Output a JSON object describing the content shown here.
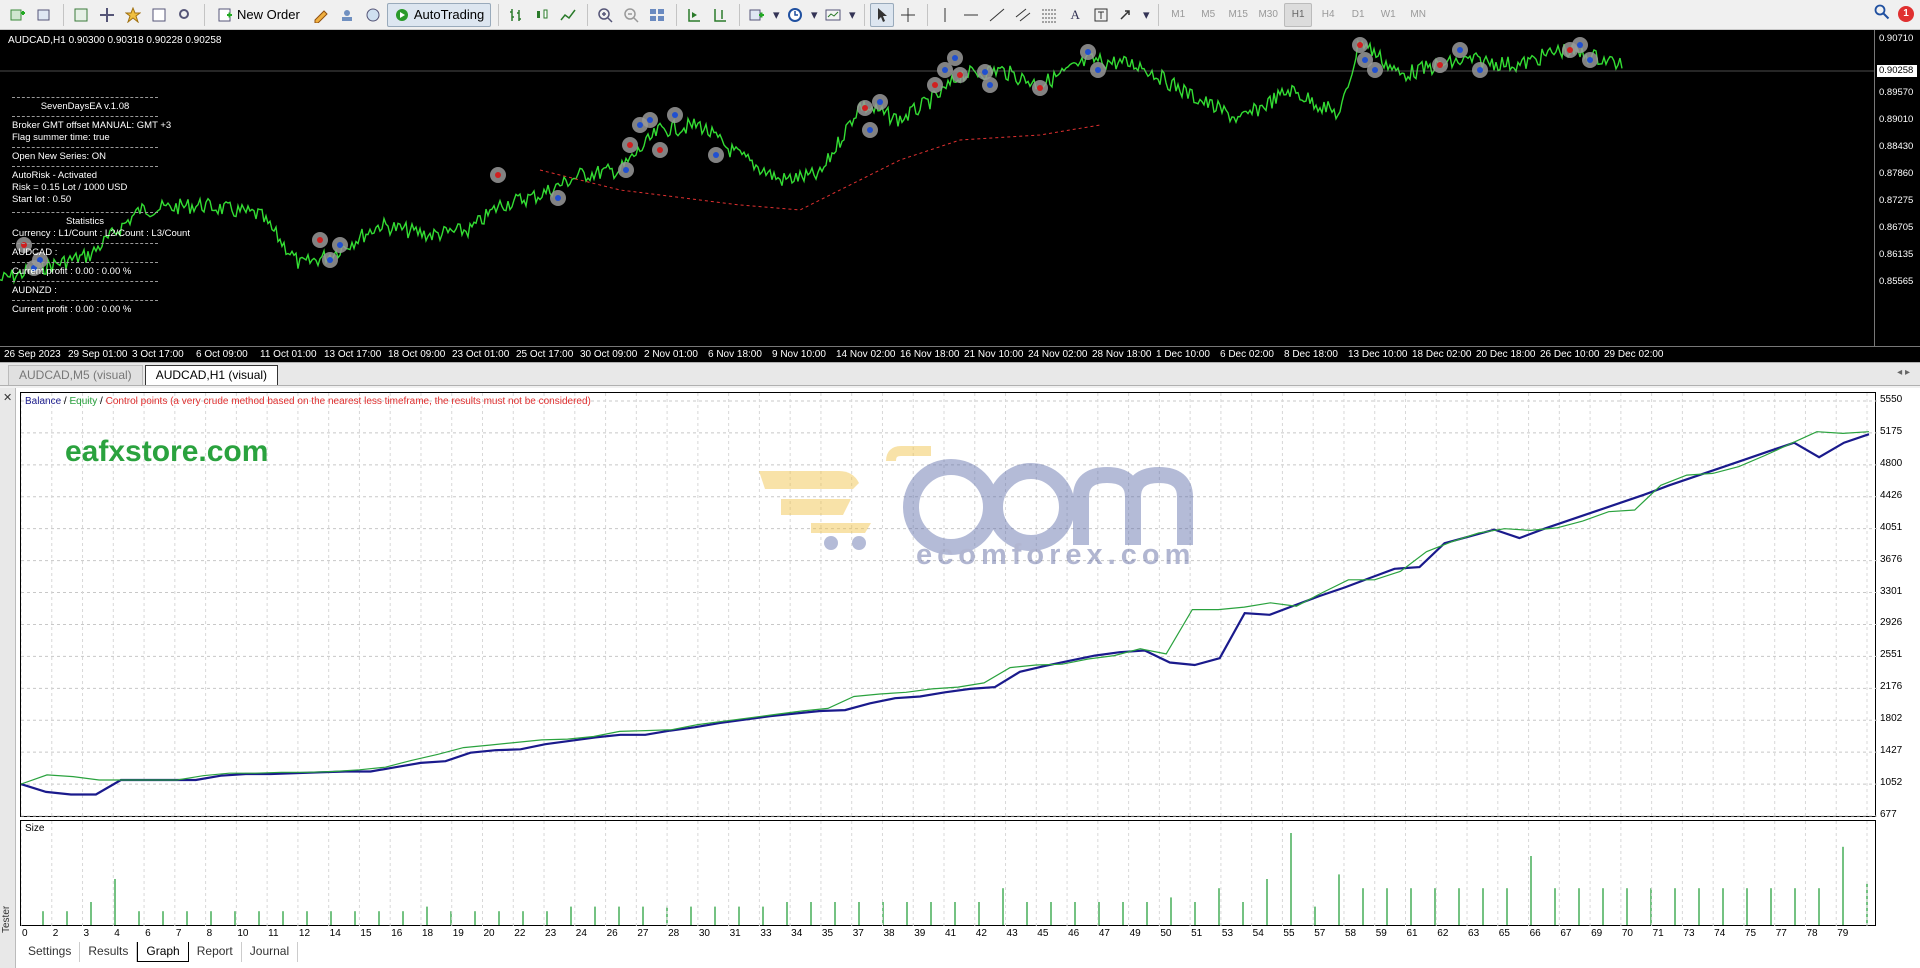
{
  "toolbar": {
    "new_order": "New Order",
    "autotrading": "AutoTrading",
    "timeframes": [
      "M1",
      "M5",
      "M15",
      "M30",
      "H1",
      "H4",
      "D1",
      "W1",
      "MN"
    ],
    "selected_timeframe": "H1",
    "notification_count": "1"
  },
  "chart": {
    "title": "AUDCAD,H1  0.90300 0.90318 0.90228 0.90258",
    "price_tag": "0.90258",
    "price_labels": [
      "0.90710",
      "0.90258",
      "0.89570",
      "0.89010",
      "0.88430",
      "0.87860",
      "0.87275",
      "0.86705",
      "0.86135",
      "0.85565"
    ],
    "time_labels": [
      "26 Sep 2023",
      "29 Sep 01:00",
      "3 Oct 17:00",
      "6 Oct 09:00",
      "11 Oct 01:00",
      "13 Oct 17:00",
      "18 Oct 09:00",
      "23 Oct 01:00",
      "25 Oct 17:00",
      "30 Oct 09:00",
      "2 Nov 01:00",
      "6 Nov 18:00",
      "9 Nov 10:00",
      "14 Nov 02:00",
      "16 Nov 18:00",
      "21 Nov 10:00",
      "24 Nov 02:00",
      "28 Nov 18:00",
      "1 Dec 10:00",
      "6 Dec 02:00",
      "8 Dec 18:00",
      "13 Dec 10:00",
      "18 Dec 02:00",
      "20 Dec 18:00",
      "26 Dec 10:00",
      "29 Dec 02:00"
    ]
  },
  "ea_panel": {
    "name": "SevenDaysEA  v.1.08",
    "broker": "Broker GMT offset MANUAL:  GMT +3",
    "summer": "Flag summer time: true",
    "open_series": "Open New Series: ON",
    "autorisk": "AutoRisk - Activated",
    "risk": "Risk = 0.15 Lot / 1000 USD",
    "start_lot": "Start lot : 0.50",
    "statistics": "Statistics",
    "currency": "Currency : L1/Count : L2/Count : L3/Count",
    "pair1": "AUDCAD :",
    "profit1": "Current profit : 0.00 : 0.00 %",
    "pair2": "AUDNZD :",
    "profit2": "Current profit : 0.00 : 0.00 %"
  },
  "chart_tabs": [
    "AUDCAD,M5 (visual)",
    "AUDCAD,H1 (visual)"
  ],
  "active_chart_tab": "AUDCAD,H1 (visual)",
  "tester": {
    "side_label": "Tester",
    "legend": {
      "balance": "Balance",
      "sep1": " / ",
      "equity": "Equity",
      "sep2": " / ",
      "control": "Control points (a very crude method based on the nearest less timeframe, the results must not be considered)"
    },
    "brand": "eafxstore.com",
    "watermark_text": "ecomforex.com",
    "size_label": "Size",
    "tabs": [
      "Settings",
      "Results",
      "Graph",
      "Report",
      "Journal"
    ],
    "active_tab": "Graph"
  },
  "colors": {
    "balance": "#1a1a8c",
    "equity": "#2aa23e",
    "control": "#e03030",
    "price": "#33dd33",
    "brand": "#2aa23e"
  },
  "chart_data": {
    "type": "line",
    "x": [
      0,
      2,
      3,
      4,
      6,
      7,
      8,
      10,
      11,
      12,
      14,
      15,
      16,
      18,
      19,
      20,
      22,
      23,
      24,
      26,
      27,
      28,
      30,
      31,
      33,
      34,
      35,
      37,
      38,
      39,
      41,
      42,
      43,
      45,
      46,
      47,
      49,
      50,
      51,
      53,
      54,
      55,
      57,
      58,
      59,
      61,
      62,
      63,
      65,
      66,
      67,
      69,
      70,
      71,
      73,
      74,
      75,
      77,
      78,
      79
    ],
    "y_ticks": [
      677,
      1052,
      1427,
      1802,
      2176,
      2551,
      2926,
      3301,
      3676,
      4051,
      4426,
      4800,
      5175,
      5550
    ],
    "x_tick_labels": [
      "0",
      "2",
      "3",
      "4",
      "6",
      "7",
      "8",
      "10",
      "11",
      "12",
      "14",
      "15",
      "16",
      "18",
      "19",
      "20",
      "22",
      "23",
      "24",
      "26",
      "27",
      "28",
      "30",
      "31",
      "33",
      "34",
      "35",
      "37",
      "38",
      "39",
      "41",
      "42",
      "43",
      "45",
      "46",
      "47",
      "49",
      "50",
      "51",
      "53",
      "54",
      "55",
      "57",
      "58",
      "59",
      "61",
      "62",
      "63",
      "65",
      "66",
      "67",
      "69",
      "70",
      "71",
      "73",
      "74",
      "75",
      "77",
      "78",
      "79"
    ],
    "ylim": [
      677,
      5550
    ],
    "series": [
      {
        "name": "Balance",
        "values": [
          1052,
          960,
          930,
          930,
          1100,
          1100,
          1100,
          1100,
          1150,
          1170,
          1170,
          1180,
          1190,
          1200,
          1200,
          1250,
          1300,
          1320,
          1420,
          1450,
          1460,
          1520,
          1560,
          1600,
          1630,
          1630,
          1680,
          1720,
          1770,
          1810,
          1850,
          1880,
          1910,
          1920,
          2000,
          2060,
          2080,
          2130,
          2170,
          2190,
          2370,
          2440,
          2500,
          2560,
          2600,
          2620,
          2480,
          2450,
          2530,
          3060,
          3040,
          3150,
          3260,
          3360,
          3470,
          3580,
          3600,
          3880,
          3960,
          4040,
          3940,
          4050,
          4150,
          4250,
          4350,
          4450,
          4560,
          4660,
          4760,
          4860,
          4960,
          5060,
          4890,
          5060,
          5160
        ]
      },
      {
        "name": "Equity",
        "values": [
          1052,
          1160,
          1140,
          1100,
          1100,
          1100,
          1100,
          1150,
          1180,
          1180,
          1190,
          1190,
          1200,
          1220,
          1250,
          1330,
          1400,
          1480,
          1510,
          1540,
          1570,
          1580,
          1610,
          1670,
          1680,
          1690,
          1750,
          1790,
          1830,
          1870,
          1910,
          1940,
          2080,
          2110,
          2130,
          2170,
          2190,
          2240,
          2420,
          2450,
          2460,
          2520,
          2560,
          2640,
          2580,
          3100,
          3100,
          3130,
          3180,
          3140,
          3300,
          3450,
          3450,
          3550,
          3780,
          3900,
          4000,
          4050,
          4030,
          4060,
          4140,
          4250,
          4270,
          4560,
          4680,
          4700,
          4780,
          4910,
          5050,
          5190,
          5170,
          5190
        ]
      }
    ],
    "size_series": {
      "name": "Size",
      "values": [
        0.3,
        0.3,
        0.5,
        1.0,
        0.3,
        0.3,
        0.3,
        0.3,
        0.3,
        0.3,
        0.3,
        0.3,
        0.3,
        0.3,
        0.3,
        0.3,
        0.4,
        0.3,
        0.3,
        0.3,
        0.3,
        0.3,
        0.4,
        0.4,
        0.4,
        0.4,
        0.4,
        0.4,
        0.4,
        0.4,
        0.4,
        0.5,
        0.5,
        0.5,
        0.5,
        0.5,
        0.5,
        0.5,
        0.5,
        0.5,
        0.8,
        0.5,
        0.5,
        0.5,
        0.5,
        0.5,
        0.5,
        0.6,
        0.5,
        0.8,
        0.5,
        1.0,
        2.0,
        0.4,
        1.1,
        0.8,
        0.8,
        0.8,
        0.8,
        0.8,
        0.8,
        0.8,
        1.5,
        0.8,
        0.8,
        0.8,
        0.8,
        0.8,
        0.8,
        0.8,
        0.8,
        0.8,
        0.8,
        0.8,
        0.8,
        1.7,
        0.9
      ]
    }
  }
}
